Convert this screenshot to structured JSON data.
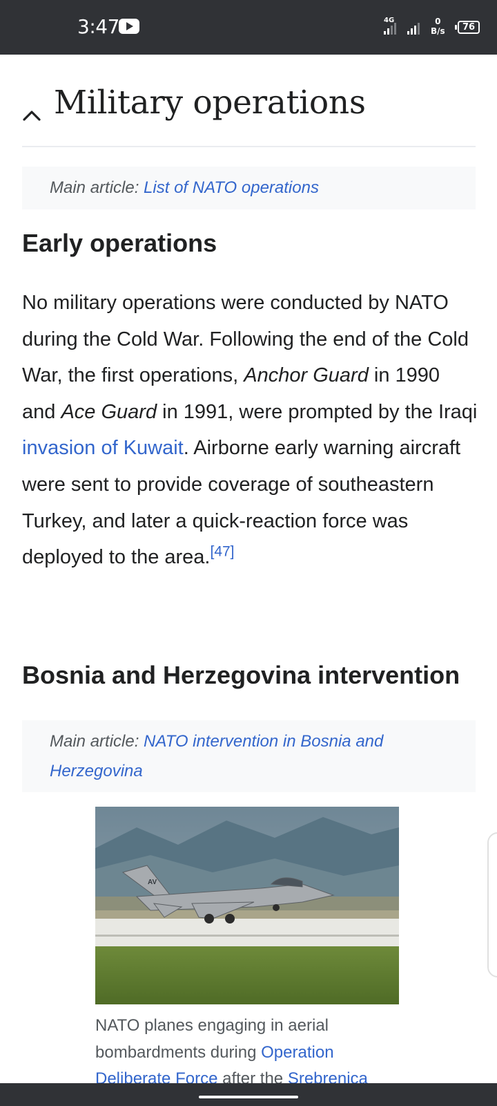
{
  "status_bar": {
    "time": "3:47",
    "network_type": "4G",
    "net_speed_value": "0",
    "net_speed_unit": "B/s",
    "battery_level": "76"
  },
  "section": {
    "title": "Military operations"
  },
  "hatnote_1": {
    "prefix": "Main article: ",
    "link": "List of NATO operations"
  },
  "early_operations": {
    "heading": "Early operations",
    "text_1": "No military operations were conducted by NATO during the Cold War. Following the end of the Cold War, the first operations, ",
    "italic_1": "Anchor Guard",
    "text_2": " in 1990 and ",
    "italic_2": "Ace Guard",
    "text_3": " in 1991, were prompted by the Iraqi ",
    "link_1": "invasion of Kuwait",
    "text_4": ". Airborne early warning aircraft were sent to provide coverage of southeastern Turkey, and later a quick-reaction force was deployed to the area.",
    "citation": "[47]"
  },
  "bosnia": {
    "heading": "Bosnia and Herzegovina intervention",
    "hatnote_prefix": "Main article: ",
    "hatnote_link": "NATO intervention in Bosnia and Herzegovina",
    "caption_text_1": "NATO planes engaging in aerial bombardments during ",
    "caption_link_1": "Operation Deliberate Force",
    "caption_text_2": " after the ",
    "caption_link_2": "Srebrenica"
  },
  "colors": {
    "link": "#3366cc",
    "hatnote_bg": "#f8f9fa",
    "status_bar_bg": "#303236"
  }
}
